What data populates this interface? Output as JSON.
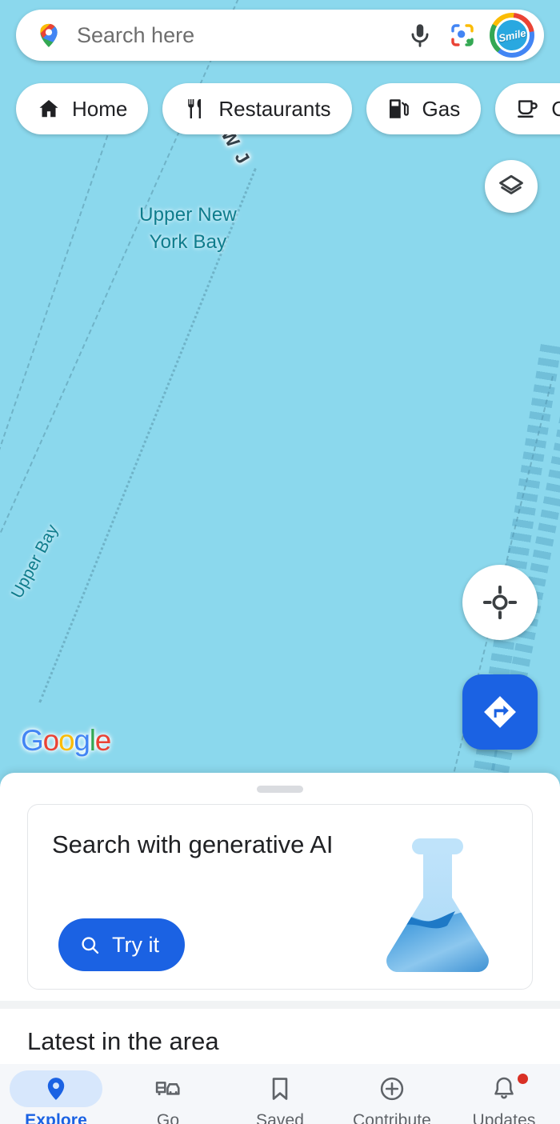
{
  "search": {
    "placeholder": "Search here",
    "mic_icon": "microphone-icon",
    "lens_icon": "google-lens-icon",
    "avatar_label": "Smile",
    "pin_icon": "google-maps-pin-icon"
  },
  "chips": [
    {
      "label": "Home",
      "icon": "home-icon"
    },
    {
      "label": "Restaurants",
      "icon": "restaurant-icon"
    },
    {
      "label": "Gas",
      "icon": "gas-station-icon"
    },
    {
      "label": "Coffee",
      "icon": "coffee-cup-icon"
    }
  ],
  "map": {
    "labels": {
      "bay": "Upper New\nYork Bay",
      "upper_bay": "Upper Bay",
      "state": "NEW J"
    },
    "watermark": "Google",
    "water_color": "#8BD8ED",
    "label_color": "#0E7C8C",
    "controls": {
      "layers": "layers-icon",
      "locate": "my-location-icon",
      "directions": "directions-icon"
    }
  },
  "sheet": {
    "genai_card": {
      "title": "Search with generative AI",
      "button_label": "Try it",
      "button_icon": "search-icon",
      "illustration": "flask-icon",
      "accent_color": "#1B62E3"
    },
    "latest_title": "Latest in the area"
  },
  "bottom_nav": {
    "items": [
      {
        "label": "Explore",
        "icon": "map-pin-icon",
        "active": true,
        "badge": false
      },
      {
        "label": "Go",
        "icon": "transit-car-icon",
        "active": false,
        "badge": false
      },
      {
        "label": "Saved",
        "icon": "bookmark-icon",
        "active": false,
        "badge": false
      },
      {
        "label": "Contribute",
        "icon": "plus-circle-icon",
        "active": false,
        "badge": false
      },
      {
        "label": "Updates",
        "icon": "bell-icon",
        "active": false,
        "badge": true
      }
    ]
  },
  "google_logo": {
    "letters": [
      "G",
      "o",
      "o",
      "g",
      "l",
      "e"
    ],
    "colors": [
      "#4285F4",
      "#EA4335",
      "#FBBC05",
      "#4285F4",
      "#34A853",
      "#EA4335"
    ]
  }
}
